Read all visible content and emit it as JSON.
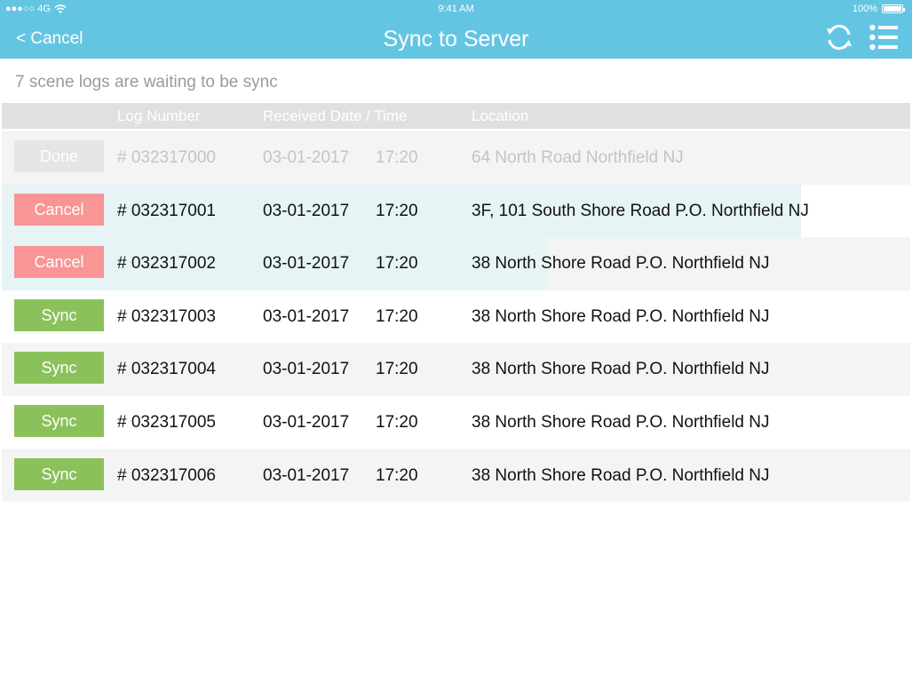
{
  "status_bar": {
    "carrier": "●●●○○ 4G",
    "time": "9:41 AM",
    "battery": "100%"
  },
  "nav": {
    "back_label": "< Cancel",
    "title": "Sync to Server"
  },
  "icons": {
    "sync": "sync-icon",
    "menu": "list-icon",
    "wifi": "wifi-icon",
    "battery": "battery-icon"
  },
  "colors": {
    "header": "#64c5e2",
    "sync": "#8bc15a",
    "cancel": "#f99595",
    "done": "#e5e5e5",
    "progress": "#e6f4f5"
  },
  "waiting_message": "7 scene logs are waiting to be sync",
  "table": {
    "columns": [
      "Log Number",
      "Received Date / Time",
      "Location"
    ],
    "rows": [
      {
        "action": "Done",
        "log": "# 032317000",
        "date": "03-01-2017",
        "time": "17:20",
        "location": "64 North Road Northfield NJ",
        "progress": 0
      },
      {
        "action": "Cancel",
        "log": "# 032317001",
        "date": "03-01-2017",
        "time": "17:20",
        "location": "3F, 101 South Shore Road P.O. Northfield NJ",
        "progress": 0.88
      },
      {
        "action": "Cancel",
        "log": "# 032317002",
        "date": "03-01-2017",
        "time": "17:20",
        "location": "38 North Shore Road P.O. Northfield NJ",
        "progress": 0.6
      },
      {
        "action": "Sync",
        "log": "# 032317003",
        "date": "03-01-2017",
        "time": "17:20",
        "location": "38 North Shore Road P.O. Northfield NJ",
        "progress": 0
      },
      {
        "action": "Sync",
        "log": "# 032317004",
        "date": "03-01-2017",
        "time": "17:20",
        "location": "38 North Shore Road P.O. Northfield NJ",
        "progress": 0
      },
      {
        "action": "Sync",
        "log": "# 032317005",
        "date": "03-01-2017",
        "time": "17:20",
        "location": "38 North Shore Road P.O. Northfield NJ",
        "progress": 0
      },
      {
        "action": "Sync",
        "log": "# 032317006",
        "date": "03-01-2017",
        "time": "17:20",
        "location": "38 North Shore Road P.O. Northfield NJ",
        "progress": 0
      }
    ]
  }
}
